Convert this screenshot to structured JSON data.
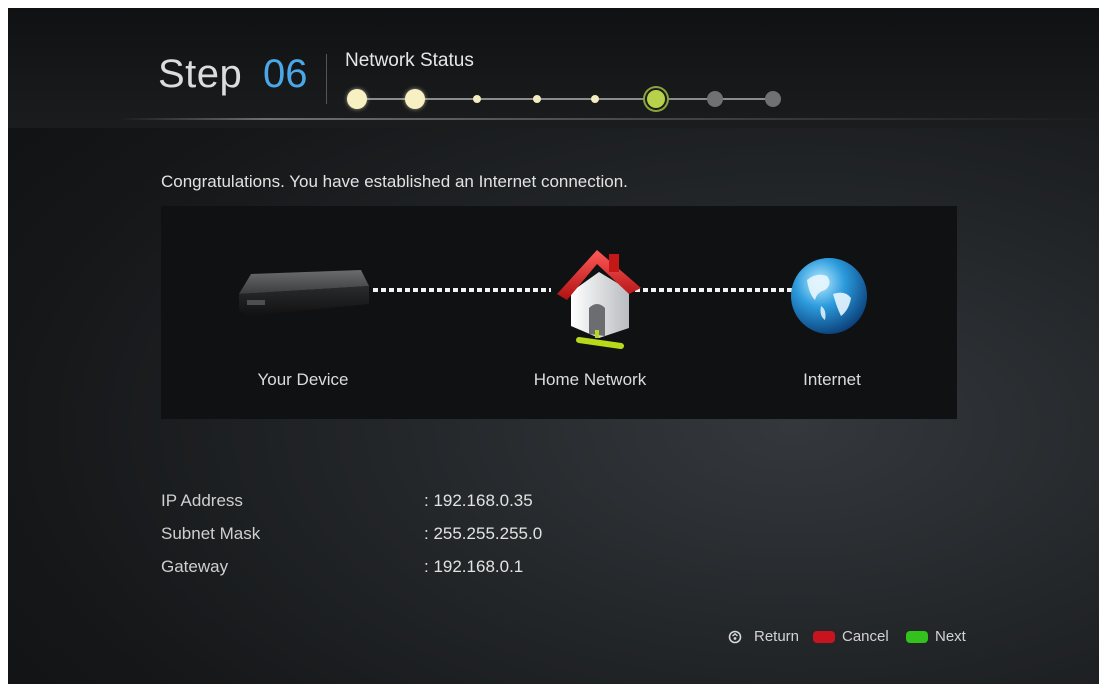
{
  "header": {
    "step_word": "Step",
    "step_number": "06",
    "title": "Network Status",
    "progress": {
      "total_steps": 8,
      "current_step": 6
    }
  },
  "message": "Congratulations. You have established an Internet connection.",
  "diagram": {
    "nodes": [
      {
        "label": "Your Device",
        "icon": "set-top-box-icon"
      },
      {
        "label": "Home Network",
        "icon": "home-network-icon"
      },
      {
        "label": "Internet",
        "icon": "globe-icon"
      }
    ]
  },
  "network_info": [
    {
      "label": "IP Address",
      "value": ": 192.168.0.35"
    },
    {
      "label": "Subnet Mask",
      "value": ": 255.255.255.0"
    },
    {
      "label": "Gateway",
      "value": ": 192.168.0.1"
    }
  ],
  "footer": {
    "return_label": "Return",
    "cancel_label": "Cancel",
    "next_label": "Next",
    "cancel_color": "#c8141e",
    "next_color": "#33c21c"
  },
  "colors": {
    "accent_blue": "#4aa8e8",
    "progress_done": "#f6f0c3",
    "progress_current": "#b8d14a",
    "progress_pending": "#6f7173"
  }
}
